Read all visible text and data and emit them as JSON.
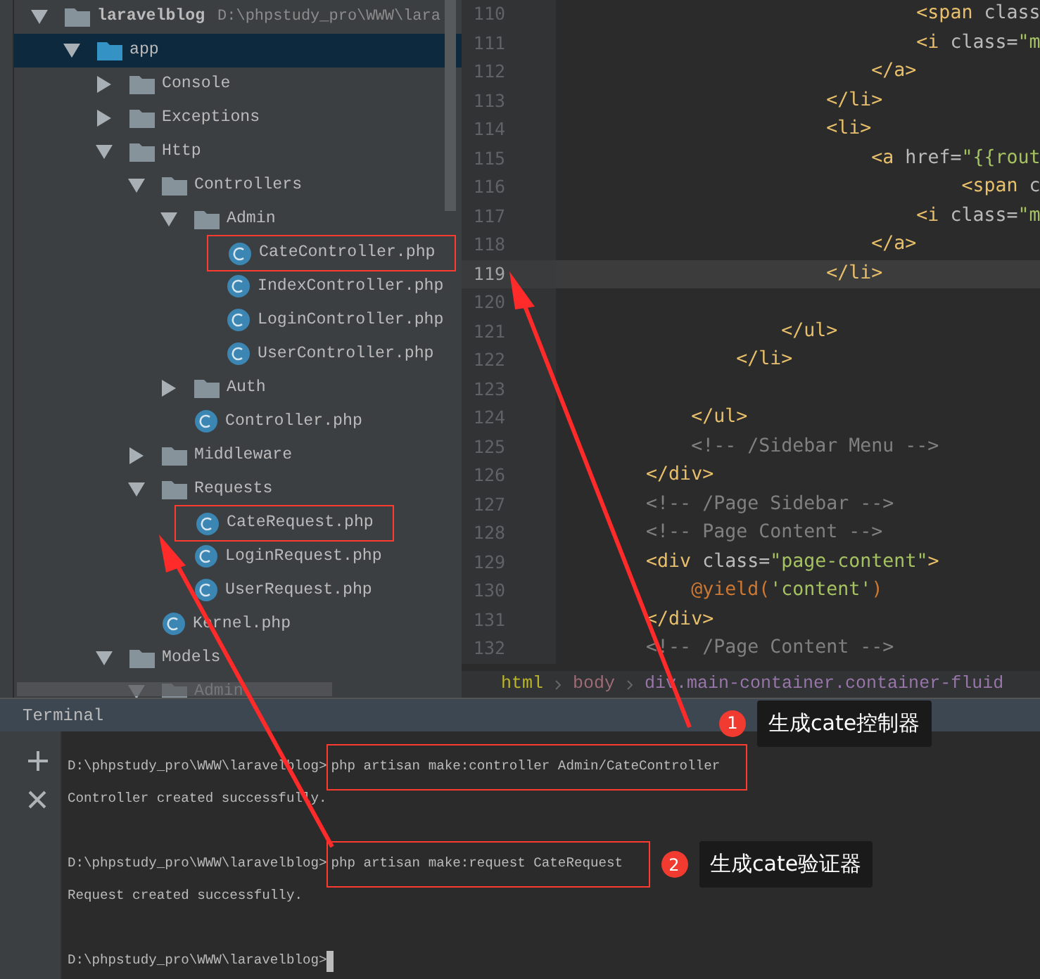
{
  "project_tree": [
    {
      "name": "laravelblog",
      "path": "D:\\phpstudy_pro\\WWW\\lara",
      "kind": "folder",
      "expanded": true,
      "selected": false,
      "children": [
        {
          "name": "app",
          "kind": "source",
          "expanded": true,
          "selected": true,
          "children": [
            {
              "name": "Console",
              "kind": "folder",
              "expanded": false,
              "selected": false
            },
            {
              "name": "Exceptions",
              "kind": "folder",
              "expanded": false,
              "selected": false
            },
            {
              "name": "Http",
              "kind": "folder",
              "expanded": true,
              "selected": false,
              "children": [
                {
                  "name": "Controllers",
                  "kind": "folder",
                  "expanded": true,
                  "selected": false,
                  "children": [
                    {
                      "name": "Admin",
                      "kind": "folder",
                      "expanded": true,
                      "selected": false,
                      "children": [
                        {
                          "name": "CateController.php",
                          "kind": "class",
                          "selected": false,
                          "boxed": true
                        },
                        {
                          "name": "IndexController.php",
                          "kind": "class",
                          "selected": false
                        },
                        {
                          "name": "LoginController.php",
                          "kind": "class",
                          "selected": false
                        },
                        {
                          "name": "UserController.php",
                          "kind": "class",
                          "selected": false
                        }
                      ]
                    },
                    {
                      "name": "Auth",
                      "kind": "folder",
                      "expanded": false,
                      "selected": false
                    },
                    {
                      "name": "Controller.php",
                      "kind": "class",
                      "selected": false
                    }
                  ]
                },
                {
                  "name": "Middleware",
                  "kind": "folder",
                  "expanded": false,
                  "selected": false
                },
                {
                  "name": "Requests",
                  "kind": "folder",
                  "expanded": true,
                  "selected": false,
                  "children": [
                    {
                      "name": "CateRequest.php",
                      "kind": "class",
                      "selected": false,
                      "boxed": true
                    },
                    {
                      "name": "LoginRequest.php",
                      "kind": "class",
                      "selected": false
                    },
                    {
                      "name": "UserRequest.php",
                      "kind": "class",
                      "selected": false
                    }
                  ]
                },
                {
                  "name": "Kernel.php",
                  "kind": "class",
                  "selected": false
                }
              ]
            },
            {
              "name": "Models",
              "kind": "folder",
              "expanded": true,
              "selected": false,
              "children": [
                {
                  "name": "Admin",
                  "kind": "folder",
                  "expanded": true,
                  "selected": false
                }
              ]
            }
          ]
        }
      ]
    }
  ],
  "editor": {
    "lines": [
      {
        "number": "110",
        "current": false,
        "tokens": [
          {
            "kind": "tag",
            "text": "                                <span"
          },
          {
            "kind": "attr",
            "text": " class"
          }
        ]
      },
      {
        "number": "111",
        "current": false,
        "tokens": [
          {
            "kind": "tag",
            "text": "                                <i"
          },
          {
            "kind": "attr",
            "text": " class="
          },
          {
            "kind": "string",
            "text": "\"m"
          }
        ]
      },
      {
        "number": "112",
        "current": false,
        "tokens": [
          {
            "kind": "tag",
            "text": "                            </a>"
          }
        ]
      },
      {
        "number": "113",
        "current": false,
        "tokens": [
          {
            "kind": "tag",
            "text": "                        </li>"
          }
        ]
      },
      {
        "number": "114",
        "current": false,
        "tokens": [
          {
            "kind": "tag",
            "text": "                        <li>"
          }
        ]
      },
      {
        "number": "115",
        "current": false,
        "tokens": [
          {
            "kind": "tag",
            "text": "                            <a"
          },
          {
            "kind": "attr",
            "text": " href="
          },
          {
            "kind": "string",
            "text": "\"{{rout"
          }
        ]
      },
      {
        "number": "116",
        "current": false,
        "tokens": [
          {
            "kind": "tag",
            "text": "                                    <span"
          },
          {
            "kind": "attr",
            "text": " c"
          }
        ]
      },
      {
        "number": "117",
        "current": false,
        "tokens": [
          {
            "kind": "tag",
            "text": "                                <i"
          },
          {
            "kind": "attr",
            "text": " class="
          },
          {
            "kind": "string",
            "text": "\"m"
          }
        ]
      },
      {
        "number": "118",
        "current": false,
        "tokens": [
          {
            "kind": "tag",
            "text": "                            </a>"
          }
        ]
      },
      {
        "number": "119",
        "current": true,
        "tokens": [
          {
            "kind": "tag",
            "text": "                        </li>"
          }
        ]
      },
      {
        "number": "120",
        "current": false
      },
      {
        "number": "121",
        "current": false,
        "tokens": [
          {
            "kind": "tag",
            "text": "                    </ul>"
          }
        ]
      },
      {
        "number": "122",
        "current": false,
        "tokens": [
          {
            "kind": "tag",
            "text": "                </li>"
          }
        ]
      },
      {
        "number": "123",
        "current": false
      },
      {
        "number": "124",
        "current": false,
        "tokens": [
          {
            "kind": "tag",
            "text": "            </ul>"
          }
        ]
      },
      {
        "number": "125",
        "current": false,
        "tokens": [
          {
            "kind": "comment",
            "text": "            <!-- /Sidebar Menu -->"
          }
        ]
      },
      {
        "number": "126",
        "current": false,
        "tokens": [
          {
            "kind": "tag",
            "text": "        </div>"
          }
        ]
      },
      {
        "number": "127",
        "current": false,
        "tokens": [
          {
            "kind": "comment",
            "text": "        <!-- /Page Sidebar -->"
          }
        ]
      },
      {
        "number": "128",
        "current": false,
        "tokens": [
          {
            "kind": "comment",
            "text": "        <!-- Page Content -->"
          }
        ]
      },
      {
        "number": "129",
        "current": false,
        "tokens": [
          {
            "kind": "tag",
            "text": "        <div"
          },
          {
            "kind": "attr",
            "text": " class="
          },
          {
            "kind": "string",
            "text": "\"page-content\""
          },
          {
            "kind": "tag",
            "text": ">"
          }
        ]
      },
      {
        "number": "130",
        "current": false,
        "tokens": [
          {
            "kind": "directive",
            "text": "            @yield"
          },
          {
            "kind": "plain",
            "text": "("
          },
          {
            "kind": "string",
            "text": "'content'"
          },
          {
            "kind": "plain",
            "text": ")"
          }
        ]
      },
      {
        "number": "131",
        "current": false,
        "tokens": [
          {
            "kind": "tag",
            "text": "        </div>"
          }
        ]
      },
      {
        "number": "132",
        "current": false,
        "tokens": [
          {
            "kind": "comment",
            "text": "        <!-- /Page Content -->"
          }
        ]
      }
    ],
    "breadcrumbs": [
      {
        "label": "html",
        "color": "#bbb529"
      },
      {
        "label": "body",
        "color": "#9e6b76"
      },
      {
        "label": "div.main-container.container-fluid",
        "color": "#9876aa"
      }
    ]
  },
  "terminal": {
    "title": "Terminal",
    "lines": [
      {
        "kind": "command",
        "prompt": "D:\\phpstudy_pro\\WWW\\laravelblog>",
        "command": "php artisan make:controller Admin/CateController",
        "boxed": true,
        "callout": {
          "number": "1",
          "label": "生成cate控制器"
        }
      },
      {
        "kind": "output",
        "text": "Controller created successfully."
      },
      {
        "kind": "command",
        "prompt": "D:\\phpstudy_pro\\WWW\\laravelblog>",
        "command": "php artisan make:request CateRequest",
        "boxed": true,
        "callout": {
          "number": "2",
          "label": "生成cate验证器"
        }
      },
      {
        "kind": "output",
        "text": "Request created successfully."
      },
      {
        "kind": "command",
        "prompt": "D:\\phpstudy_pro\\WWW\\laravelblog>",
        "cursor": true
      }
    ]
  }
}
